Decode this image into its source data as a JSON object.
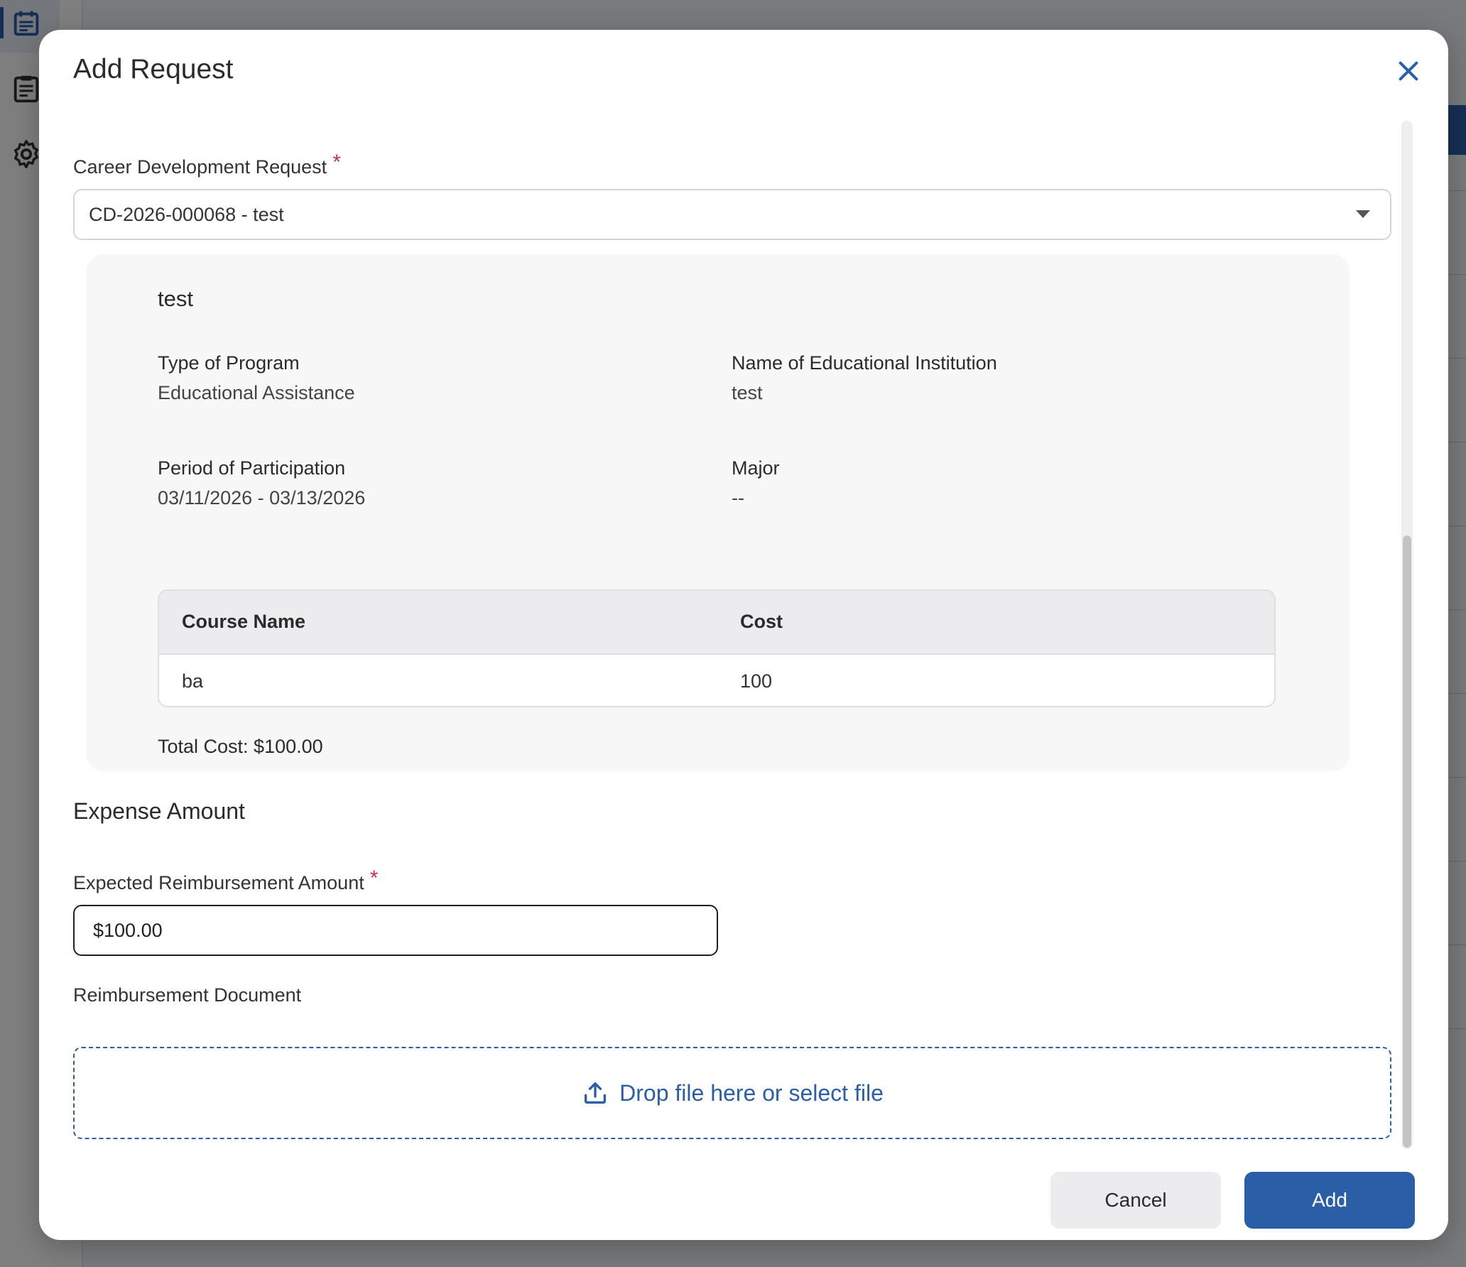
{
  "modal": {
    "title": "Add Request",
    "close_icon": "close-icon"
  },
  "career_request": {
    "label": "Career Development Request",
    "required_mark": "*",
    "selected_value": "CD-2026-000068 - test"
  },
  "request_details": {
    "title": "test",
    "type_of_program": {
      "label": "Type of Program",
      "value": "Educational Assistance"
    },
    "institution": {
      "label": "Name of Educational Institution",
      "value": "test"
    },
    "period": {
      "label": "Period of Participation",
      "value": "03/11/2026 - 03/13/2026"
    },
    "major": {
      "label": "Major",
      "value": "--"
    },
    "courses": {
      "headers": [
        "Course Name",
        "Cost"
      ],
      "rows": [
        {
          "course_name": "ba",
          "cost": "100"
        }
      ]
    },
    "total_cost": "Total Cost: $100.00"
  },
  "expense": {
    "section_title": "Expense Amount",
    "reimbursement_label": "Expected Reimbursement Amount",
    "required_mark": "*",
    "reimbursement_value": "$100.00"
  },
  "document": {
    "label": "Reimbursement Document",
    "dropzone_text": "Drop file here or select file",
    "upload_icon": "upload-icon"
  },
  "actions": {
    "cancel_label": "Cancel",
    "add_label": "Add"
  },
  "colors": {
    "accent": "#2a5fa8",
    "required": "#c8334a",
    "card_bg": "#f7f7f7"
  }
}
